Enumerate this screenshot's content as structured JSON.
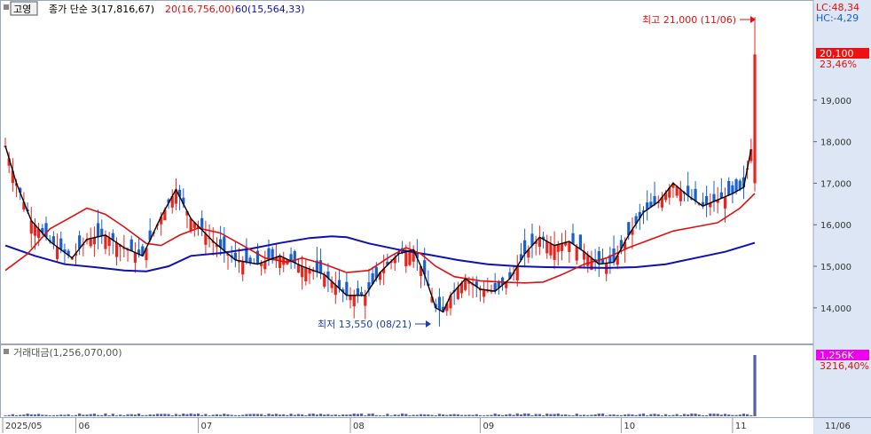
{
  "legend": {
    "badge": "고영",
    "close_label": "종가 단순 3(17,816,67)",
    "ma20_label": "20(16,756,00)",
    "ma60_label": "60(15,564,33)"
  },
  "volume_legend": "거래대금(1,256,070,00)",
  "annotations": {
    "high": "최고 21,000 (11/06)",
    "low": "최저 13,550 (08/21)"
  },
  "right_panel": {
    "lc": "LC:48,34",
    "hc": "HC:-4,29",
    "price_box": "20,100",
    "price_change": "23,46%",
    "volume_box": "1,256K",
    "volume_change": "3216,40%"
  },
  "colors": {
    "up": "#e8261d",
    "down": "#1a5fd0",
    "ma3": "#000000",
    "ma20": "#e01010",
    "ma60": "#1010b0",
    "volume": "#5560a8",
    "price_tag": "#ee1111",
    "volume_tag": "#ee00ee",
    "axis_bg": "#dde6f4"
  },
  "chart_data": {
    "type": "candlestick",
    "y_ticks": [
      14000,
      15000,
      16000,
      17000,
      18000,
      19000,
      20000
    ],
    "ylim": [
      13200,
      21400
    ],
    "x_labels": [
      {
        "text": "2025/05",
        "i": 0
      },
      {
        "text": "06",
        "i": 19
      },
      {
        "text": "07",
        "i": 52
      },
      {
        "text": "08",
        "i": 93
      },
      {
        "text": "09",
        "i": 128
      },
      {
        "text": "10",
        "i": 166
      },
      {
        "text": "11",
        "i": 196
      }
    ],
    "last_date_label": "11/06",
    "high": {
      "value": 21000,
      "i": 201
    },
    "low": {
      "value": 13550,
      "i": 117
    },
    "last_close": 20100,
    "ma3": [
      [
        0,
        17900
      ],
      [
        3,
        17000
      ],
      [
        7,
        16100
      ],
      [
        12,
        15600
      ],
      [
        18,
        15200
      ],
      [
        22,
        15650
      ],
      [
        27,
        15750
      ],
      [
        32,
        15450
      ],
      [
        37,
        15250
      ],
      [
        42,
        16200
      ],
      [
        46,
        16850
      ],
      [
        50,
        16150
      ],
      [
        56,
        15600
      ],
      [
        62,
        15150
      ],
      [
        68,
        15050
      ],
      [
        74,
        15250
      ],
      [
        80,
        15000
      ],
      [
        86,
        14800
      ],
      [
        92,
        14300
      ],
      [
        97,
        14300
      ],
      [
        101,
        14850
      ],
      [
        106,
        15300
      ],
      [
        110,
        15400
      ],
      [
        113,
        14800
      ],
      [
        116,
        14000
      ],
      [
        118,
        13900
      ],
      [
        120,
        14300
      ],
      [
        124,
        14700
      ],
      [
        128,
        14450
      ],
      [
        132,
        14400
      ],
      [
        136,
        14700
      ],
      [
        140,
        15300
      ],
      [
        144,
        15700
      ],
      [
        148,
        15500
      ],
      [
        152,
        15600
      ],
      [
        156,
        15350
      ],
      [
        160,
        15050
      ],
      [
        164,
        15100
      ],
      [
        168,
        15750
      ],
      [
        172,
        16300
      ],
      [
        176,
        16550
      ],
      [
        180,
        17000
      ],
      [
        184,
        16700
      ],
      [
        188,
        16450
      ],
      [
        192,
        16600
      ],
      [
        196,
        16750
      ],
      [
        199,
        16900
      ],
      [
        201,
        17816
      ]
    ],
    "ma20": [
      [
        0,
        14900
      ],
      [
        6,
        15300
      ],
      [
        12,
        15900
      ],
      [
        18,
        16200
      ],
      [
        22,
        16400
      ],
      [
        27,
        16250
      ],
      [
        32,
        15950
      ],
      [
        38,
        15550
      ],
      [
        42,
        15500
      ],
      [
        47,
        15750
      ],
      [
        52,
        15920
      ],
      [
        58,
        15800
      ],
      [
        64,
        15500
      ],
      [
        70,
        15200
      ],
      [
        76,
        15100
      ],
      [
        80,
        15200
      ],
      [
        86,
        15050
      ],
      [
        92,
        14850
      ],
      [
        98,
        14900
      ],
      [
        104,
        15250
      ],
      [
        108,
        15450
      ],
      [
        112,
        15300
      ],
      [
        116,
        15000
      ],
      [
        121,
        14750
      ],
      [
        128,
        14650
      ],
      [
        134,
        14620
      ],
      [
        140,
        14600
      ],
      [
        145,
        14620
      ],
      [
        150,
        14800
      ],
      [
        156,
        15050
      ],
      [
        162,
        15200
      ],
      [
        168,
        15450
      ],
      [
        174,
        15650
      ],
      [
        180,
        15850
      ],
      [
        186,
        15950
      ],
      [
        192,
        16050
      ],
      [
        198,
        16400
      ],
      [
        202,
        16756
      ]
    ],
    "ma60": [
      [
        0,
        15500
      ],
      [
        8,
        15250
      ],
      [
        16,
        15050
      ],
      [
        24,
        14980
      ],
      [
        32,
        14900
      ],
      [
        38,
        14880
      ],
      [
        44,
        15000
      ],
      [
        50,
        15250
      ],
      [
        58,
        15320
      ],
      [
        66,
        15420
      ],
      [
        74,
        15560
      ],
      [
        82,
        15680
      ],
      [
        88,
        15720
      ],
      [
        92,
        15700
      ],
      [
        98,
        15550
      ],
      [
        106,
        15400
      ],
      [
        114,
        15280
      ],
      [
        122,
        15150
      ],
      [
        130,
        15050
      ],
      [
        138,
        15000
      ],
      [
        146,
        14980
      ],
      [
        154,
        14970
      ],
      [
        162,
        14960
      ],
      [
        170,
        14980
      ],
      [
        178,
        15050
      ],
      [
        186,
        15200
      ],
      [
        194,
        15350
      ],
      [
        202,
        15564
      ]
    ],
    "volume_max": 1256070
  }
}
